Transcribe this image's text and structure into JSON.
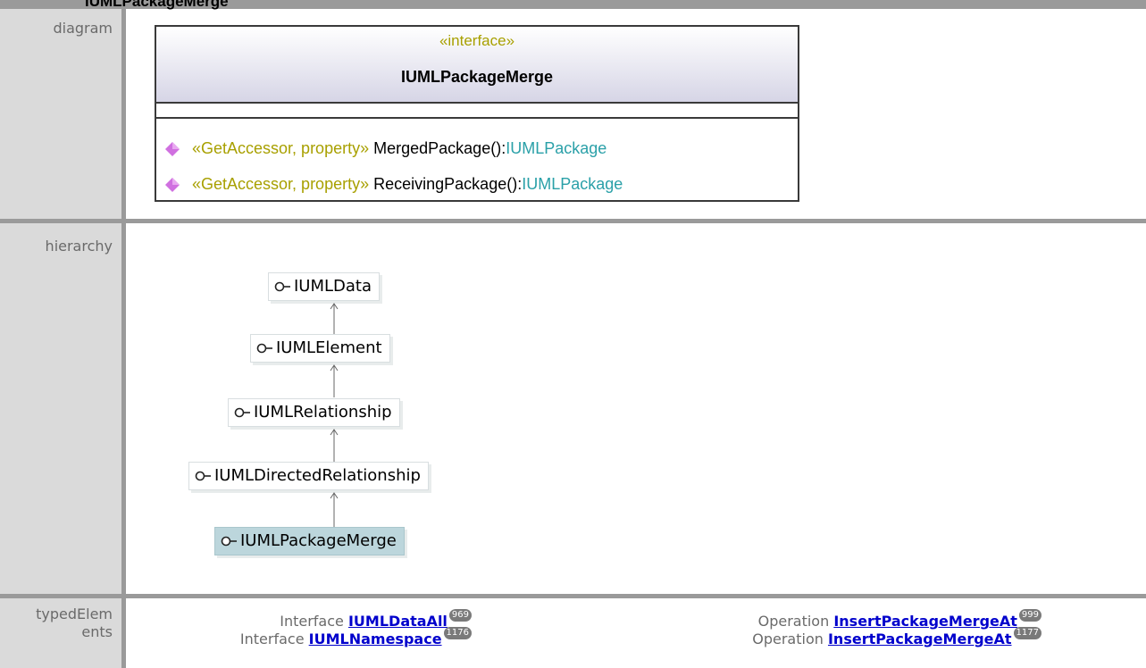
{
  "header": {
    "title_fragment": "IUMLPackageMerge"
  },
  "rows": {
    "diagram_label": "diagram",
    "hierarchy_label": "hierarchy",
    "typed_label": "typedElem\nents"
  },
  "uml_class": {
    "stereotype": "«interface»",
    "name": "IUMLPackageMerge",
    "operations": [
      {
        "stereotype": "«GetAccessor, property»",
        "name": "MergedPackage():",
        "type": "IUMLPackage"
      },
      {
        "stereotype": "«GetAccessor, property»",
        "name": "ReceivingPackage():",
        "type": "IUMLPackage"
      }
    ]
  },
  "hierarchy": [
    {
      "name": "IUMLData"
    },
    {
      "name": "IUMLElement"
    },
    {
      "name": "IUMLRelationship"
    },
    {
      "name": "IUMLDirectedRelationship"
    },
    {
      "name": "IUMLPackageMerge",
      "current": true
    }
  ],
  "typed_elements": [
    {
      "kind": "Interface",
      "name": "IUMLDataAll",
      "page": "969"
    },
    {
      "kind": "Interface",
      "name": "IUMLNamespace",
      "page": "1176"
    },
    {
      "kind": "Operation",
      "name": "InsertPackageMergeAt",
      "page": "999"
    },
    {
      "kind": "Operation",
      "name": "InsertPackageMergeAt",
      "page": "1177"
    }
  ],
  "colors": {
    "label_cell": "#dadada",
    "grid": "#9a9a9a",
    "stereotype": "#a8a000",
    "type": "#2aa0a8",
    "operation_icon": "#d070e0",
    "current_node": "#bcd6dc",
    "link": "#0000cc"
  },
  "icons": {
    "operation": "purple-diamond-icon",
    "interface": "lollipop-interface-icon"
  }
}
